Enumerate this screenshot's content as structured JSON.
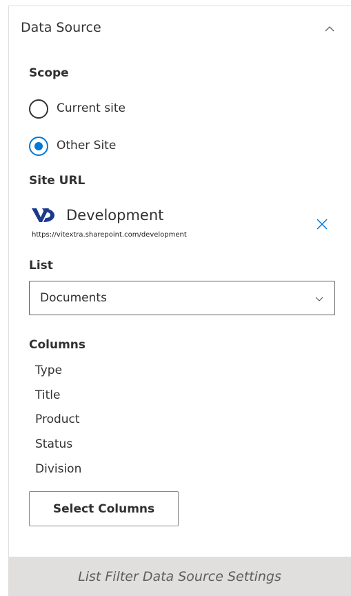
{
  "panel": {
    "title": "Data Source",
    "collapse_icon": "chevron-up-icon"
  },
  "scope": {
    "label": "Scope",
    "options": [
      {
        "label": "Current site",
        "selected": false
      },
      {
        "label": "Other Site",
        "selected": true
      }
    ]
  },
  "site_url": {
    "label": "Site URL",
    "site_name": "Development",
    "url": "https://vitextra.sharepoint.com/development",
    "logo_icon": "vitextra-logo-icon",
    "remove_icon": "close-icon"
  },
  "list": {
    "label": "List",
    "selected": "Documents",
    "chevron_icon": "chevron-down-icon"
  },
  "columns": {
    "label": "Columns",
    "items": [
      "Type",
      "Title",
      "Product",
      "Status",
      "Division"
    ],
    "button_label": "Select Columns"
  },
  "caption": "List Filter Data Source Settings",
  "colors": {
    "accent": "#0078d4",
    "logo": "#1b3a8c",
    "caption_bg": "#e1dfdd"
  }
}
